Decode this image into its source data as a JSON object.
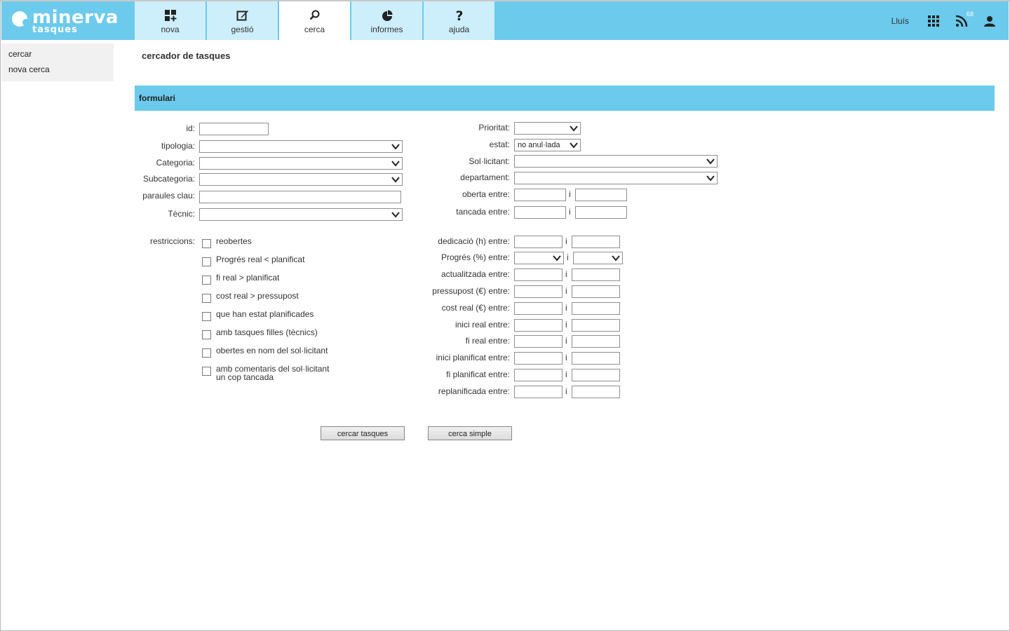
{
  "app": {
    "logo_word": "minerva",
    "logo_sub": "tasques"
  },
  "tabs": [
    {
      "label": "nova",
      "icon": "grid-plus-icon"
    },
    {
      "label": "gestió",
      "icon": "edit-icon"
    },
    {
      "label": "cerca",
      "icon": "search-icon",
      "active": true
    },
    {
      "label": "informes",
      "icon": "pie-chart-icon"
    },
    {
      "label": "ajuda",
      "icon": "question-icon"
    }
  ],
  "header_right": {
    "user": "Lluís",
    "rss_count": "68"
  },
  "sidebar": {
    "items": [
      "cercar",
      "nova cerca"
    ]
  },
  "page_title": "cercador de tasques",
  "section_title": "formulari",
  "left_fields": {
    "id": "id:",
    "tipologia": "tipologia:",
    "categoria": "Categoria:",
    "subcategoria": "Subcategoria:",
    "paraules_clau": "paraules clau:",
    "tecnic": "Tècnic:"
  },
  "restriccions": {
    "label": "restriccions:",
    "items": [
      "reobertes",
      "Progrés real < planificat",
      "fi real > planificat",
      "cost real > pressupost",
      "que han estat planificades",
      "amb tasques filles (tècnics)",
      "obertes en nom del sol·licitant",
      "amb comentaris del sol·licitant",
      "un cop tancada"
    ]
  },
  "right_fields": {
    "prioritat": "Prioritat:",
    "estat": "estat:",
    "estat_value": "no anul·lada",
    "sollicitant": "Sol·licitant:",
    "departament": "departament:",
    "oberta": "oberta entre:",
    "tancada": "tancada entre:"
  },
  "ranges": [
    "dedicació (h) entre:",
    "Progrés (%) entre:",
    "actualitzada entre:",
    "pressupost (€) entre:",
    "cost real (€) entre:",
    "inici real entre:",
    "fi real entre:",
    "inici planificat entre:",
    "fi planificat entre:",
    "replanificada entre:"
  ],
  "range_sep": "i",
  "buttons": {
    "search": "cercar tasques",
    "simple": "cerca simple"
  },
  "colors": {
    "accent": "#6ccaec",
    "tab_bg": "#cdeefb"
  }
}
